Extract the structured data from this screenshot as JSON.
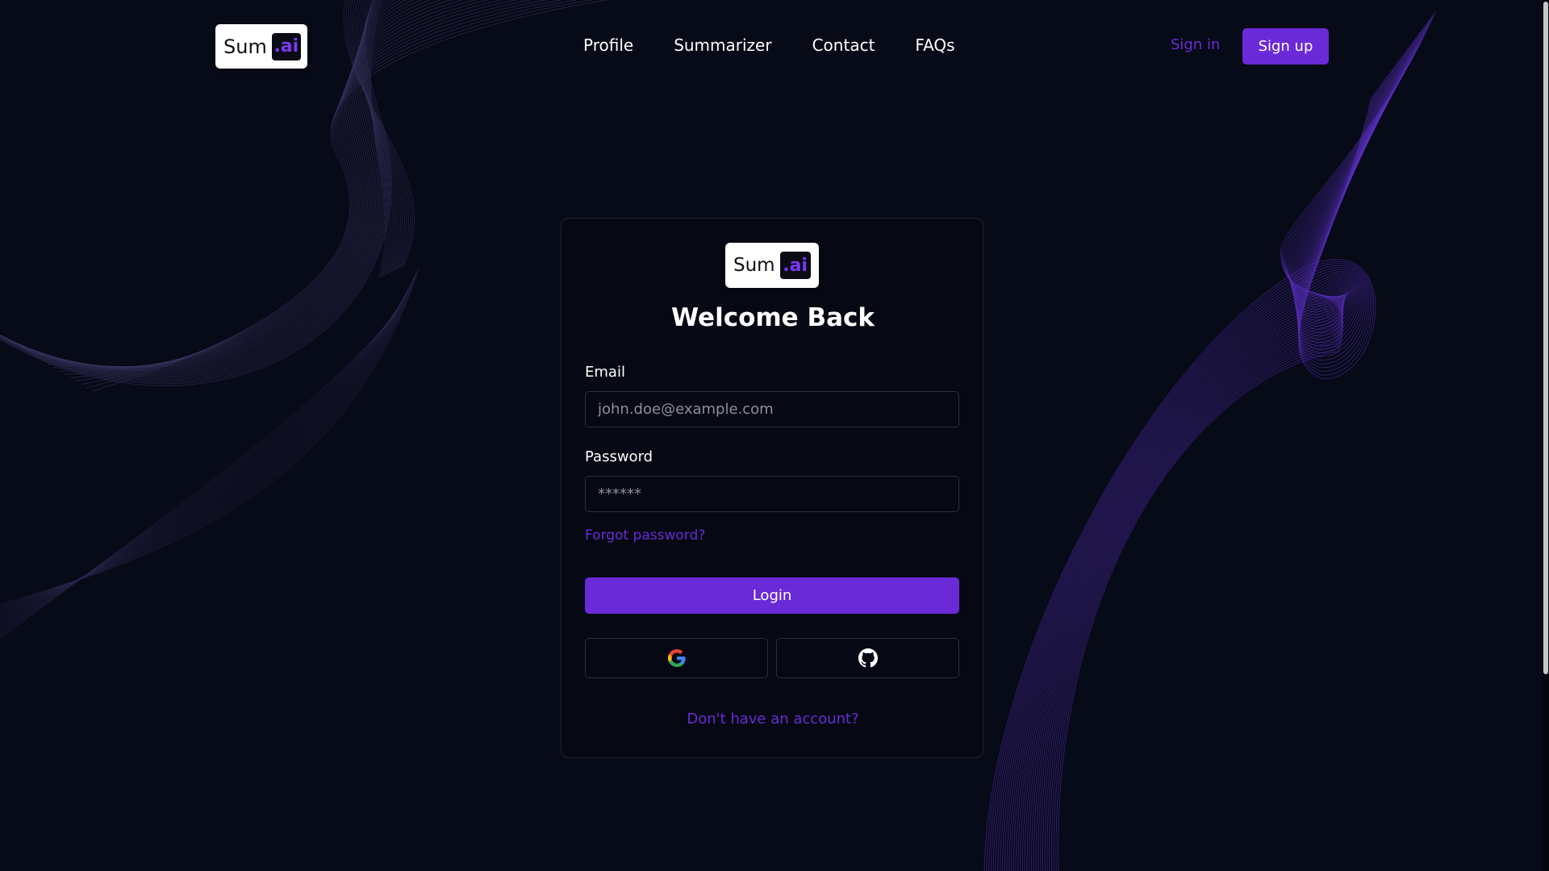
{
  "brand": {
    "name": "Sum",
    "suffix": ".ai"
  },
  "nav": {
    "links": [
      "Profile",
      "Summarizer",
      "Contact",
      "FAQs"
    ],
    "signin_label": "Sign in",
    "signup_label": "Sign up"
  },
  "login": {
    "title": "Welcome Back",
    "email_label": "Email",
    "email_placeholder": "john.doe@example.com",
    "password_label": "Password",
    "password_placeholder": "******",
    "forgot_label": "Forgot password?",
    "login_label": "Login",
    "social": [
      "google-icon",
      "github-icon"
    ],
    "signup_prompt": "Don't have an account?"
  },
  "colors": {
    "background": "#070a17",
    "accent": "#6b2ad8",
    "card_border": "#22252f"
  }
}
